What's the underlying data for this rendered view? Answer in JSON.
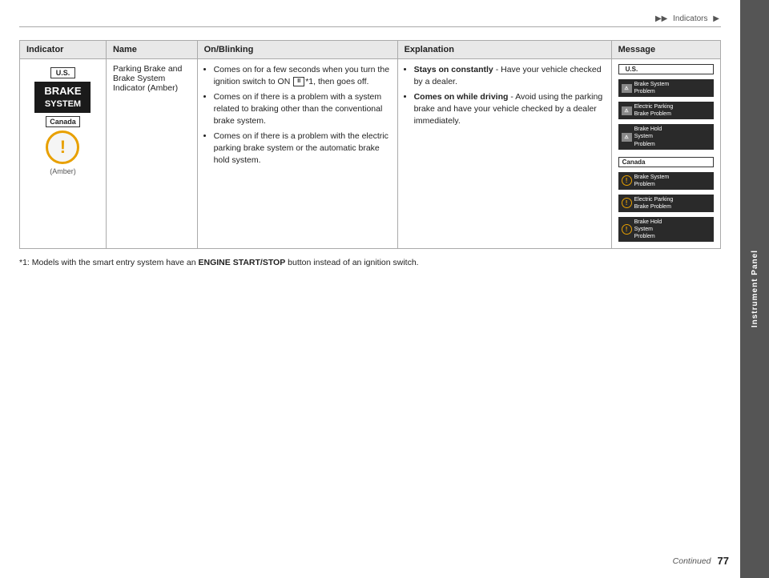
{
  "breadcrumb": {
    "items": [
      "▶▶",
      "Indicators",
      "▶"
    ]
  },
  "sidebar": {
    "label": "Instrument Panel"
  },
  "table": {
    "headers": [
      "Indicator",
      "Name",
      "On/Blinking",
      "Explanation",
      "Message"
    ],
    "row": {
      "indicator": {
        "us_badge": "U.S.",
        "brake_label": "BRAKE",
        "brake_sub": "SYSTEM",
        "canada_badge": "Canada",
        "amber_label": "(Amber)"
      },
      "name": "Parking Brake and Brake System Indicator (Amber)",
      "on_blinking": [
        "Comes on for a few seconds when you turn the ignition switch to ON [II]*1, then goes off.",
        "Comes on if there is a problem with a system related to braking other than the conventional brake system.",
        "Comes on if there is a problem with the electric parking brake system or the automatic brake hold system."
      ],
      "explanation": {
        "bullets": [
          {
            "term": "Stays on constantly",
            "text": " - Have your vehicle checked by a dealer."
          },
          {
            "term": "Comes on while driving",
            "text": " - Avoid using the parking brake and have your vehicle checked by a dealer immediately."
          }
        ]
      },
      "message": {
        "us_label": "U.S.",
        "us_items": [
          {
            "icon": "rect",
            "text": "Brake System\nProblem"
          },
          {
            "icon": "rect",
            "text": "Electric Parking\nBrake Problem"
          },
          {
            "icon": "rect",
            "text": "Brake Hold\nSystem\nProblem"
          }
        ],
        "canada_label": "Canada",
        "canada_items": [
          {
            "icon": "circ",
            "text": "Brake System\nProblem"
          },
          {
            "icon": "circ",
            "text": "Electric Parking\nBrake Problem"
          },
          {
            "icon": "circ",
            "text": "Brake Hold\nSystem\nProblem"
          }
        ]
      }
    }
  },
  "footnote": "* 1: Models with the smart entry system have an ENGINE START/STOP button instead of an ignition switch.",
  "footer": {
    "continued": "Continued",
    "page": "77"
  }
}
